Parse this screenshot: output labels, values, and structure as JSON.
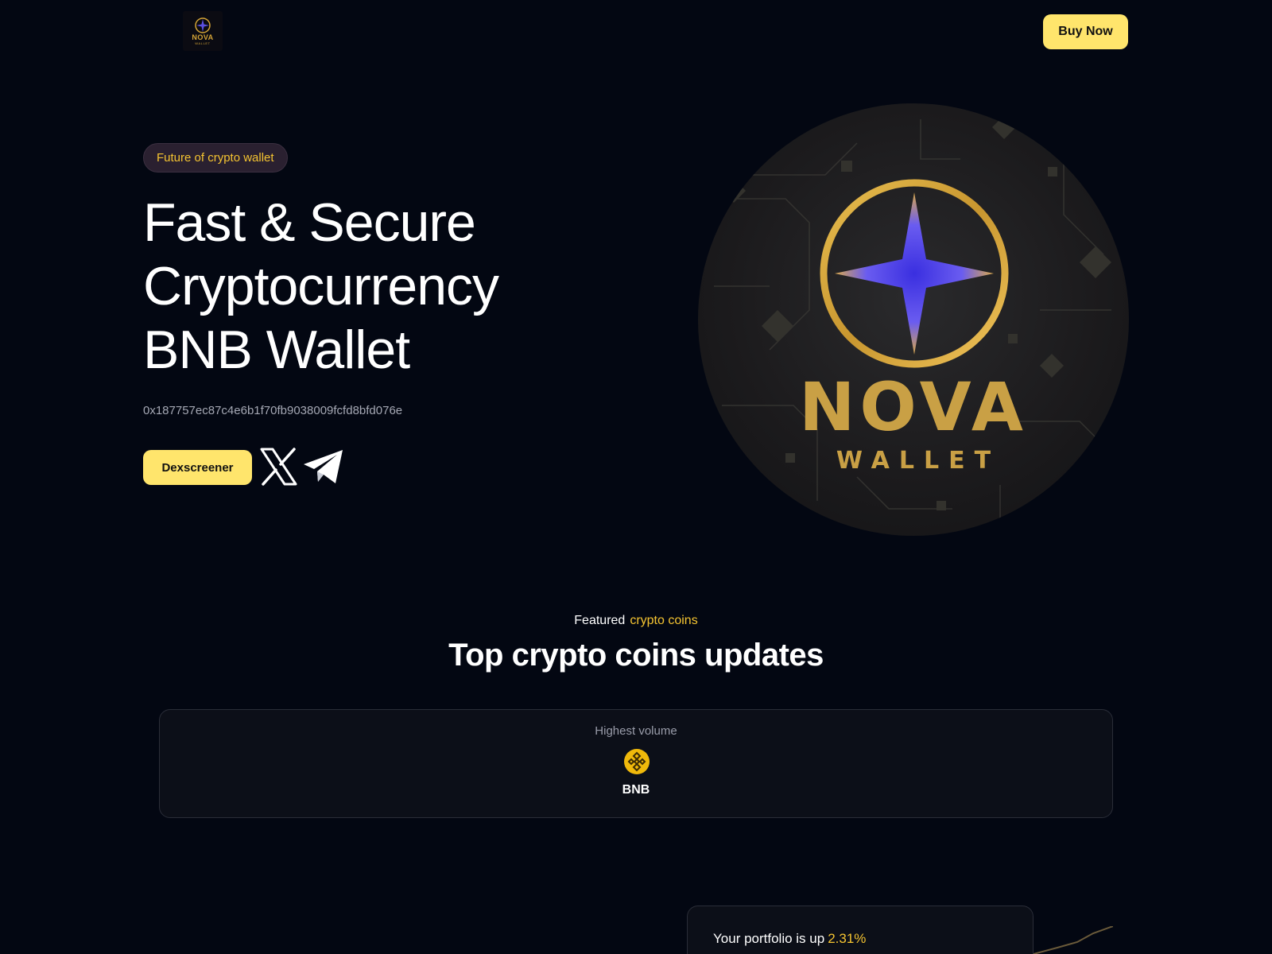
{
  "header": {
    "logo": {
      "text": "NOVA",
      "sub": "WALLET"
    },
    "buy_now_label": "Buy Now"
  },
  "hero": {
    "pill_label": "Future of crypto wallet",
    "title_lines": [
      "Fast & Secure",
      "Cryptocurrency",
      "BNB Wallet"
    ],
    "contract_address": "0x187757ec87c4e6b1f70fb9038009fcfd8bfd076e",
    "dex_button_label": "Dexscreener",
    "art": {
      "brand": "NOVA",
      "sub": "WALLET"
    }
  },
  "featured": {
    "label_prefix": "Featured",
    "label_highlight": "crypto coins",
    "title": "Top crypto coins updates",
    "card": {
      "label": "Highest volume",
      "coin_name": "BNB",
      "coin_icon": "bnb-icon"
    }
  },
  "portfolio": {
    "text": "Your portfolio is up",
    "percent": "2.31%"
  },
  "colors": {
    "background": "#030712",
    "accent": "#ffe56c",
    "highlight": "#f5c431",
    "gold": "#c9a045"
  }
}
